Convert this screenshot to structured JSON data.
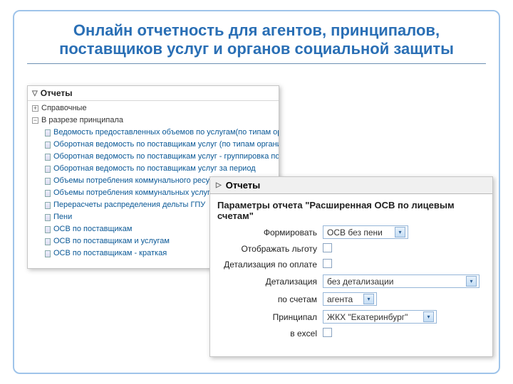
{
  "slide": {
    "title": "Онлайн отчетность для агентов, принципалов, поставщиков услуг и органов социальной защиты"
  },
  "tree": {
    "header": "Отчеты",
    "cat_ref": "Справочные",
    "cat_princ": "В разрезе принципала",
    "items": [
      "Ведомость предоставленных объемов по услугам(по типам организаций)",
      "Оборотная ведомость по поставщикам услуг (по типам организаций)",
      "Оборотная ведомость по поставщикам услуг - группировка по домам",
      "Оборотная ведомость по поставщикам услуг за период",
      "Объемы потребления коммунального ресурса по пос",
      "Объемы потребления коммунальных услуг по дома",
      "Перерасчеты распределения дельты ГПУ",
      "Пени",
      "ОСВ по поставщикам",
      "ОСВ по поставщикам и услугам",
      "ОСВ по поставщикам - краткая"
    ]
  },
  "params": {
    "header": "Отчеты",
    "title": "Параметры отчета \"Расширенная ОСВ по лицевым счетам\"",
    "labels": {
      "form": "Формировать",
      "show_lgota": "Отображать льготу",
      "detail_pay": "Детализация по оплате",
      "detail": "Детализация",
      "by_accounts": "по счетам",
      "principal": "Принципал",
      "excel": "в excel"
    },
    "values": {
      "form": "ОСВ без пени",
      "detail": "без детализации",
      "by_accounts": "агента",
      "principal": "ЖКХ \"Екатеринбург\""
    }
  }
}
